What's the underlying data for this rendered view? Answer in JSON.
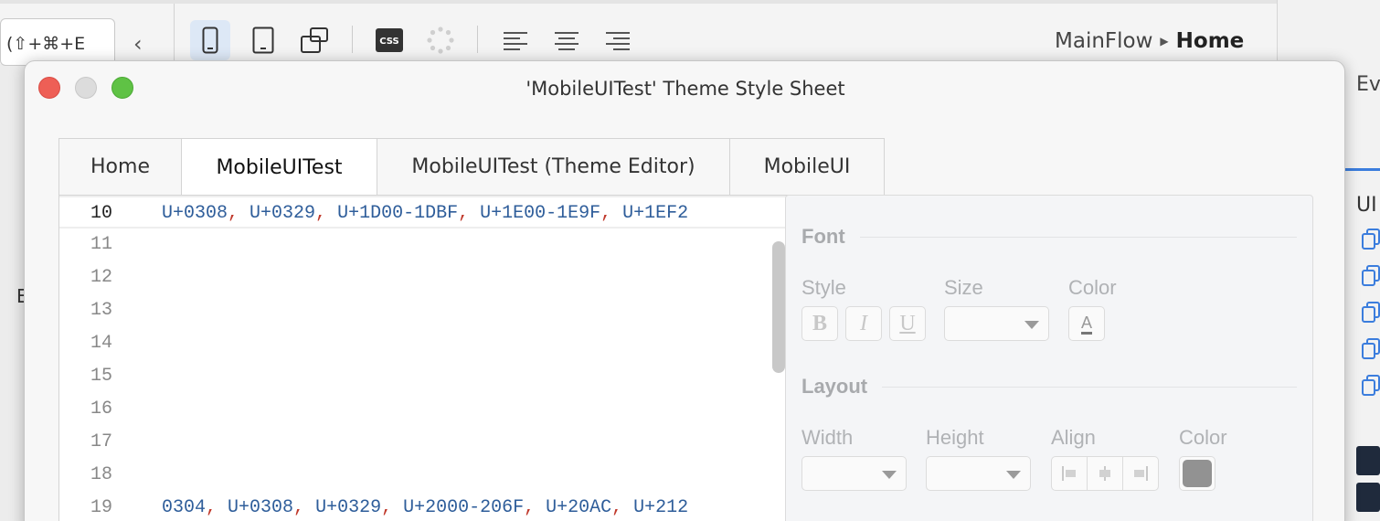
{
  "background": {
    "shortcut_text": "(⇧+⌘+E",
    "back_glyph": "‹",
    "breadcrumb": {
      "parent": "MainFlow",
      "current": "Home"
    },
    "right_text": "Ev",
    "right_ui_text": "UI",
    "left_text": "E",
    "toolbar_css_label": "CSS"
  },
  "window": {
    "title": "'MobileUITest' Theme Style Sheet"
  },
  "tabs": [
    {
      "label": "Home"
    },
    {
      "label": "MobileUITest"
    },
    {
      "label": "MobileUITest (Theme Editor)"
    },
    {
      "label": "MobileUI"
    }
  ],
  "active_tab": 1,
  "editor": {
    "lines": [
      {
        "number": "10",
        "tokens": [
          "U+0308",
          "U+0329",
          "U+1D00-1DBF",
          "U+1E00-1E9F",
          "U+1EF2"
        ]
      },
      {
        "number": "11",
        "tokens": []
      },
      {
        "number": "12",
        "tokens": []
      },
      {
        "number": "13",
        "tokens": []
      },
      {
        "number": "14",
        "tokens": []
      },
      {
        "number": "15",
        "tokens": []
      },
      {
        "number": "16",
        "tokens": []
      },
      {
        "number": "17",
        "tokens": []
      },
      {
        "number": "18",
        "tokens": []
      },
      {
        "number": "19",
        "tokens": [
          "0304",
          "U+0308",
          "U+0329",
          "U+2000-206F",
          "U+20AC",
          "U+212"
        ]
      }
    ]
  },
  "properties": {
    "font": {
      "title": "Font",
      "style_label": "Style",
      "size_label": "Size",
      "color_label": "Color",
      "bold": "B",
      "italic": "I",
      "underline": "U",
      "color_glyph": "A"
    },
    "layout": {
      "title": "Layout",
      "width_label": "Width",
      "height_label": "Height",
      "align_label": "Align",
      "color_label": "Color",
      "color_value": "#929292"
    }
  },
  "colors": {
    "accent": "#3b7ddd",
    "close": "#ee5f56",
    "minimize": "#dcdcdc",
    "maximize": "#5fc245",
    "code_token": "#2e5d9a",
    "code_separator": "#c0392b"
  }
}
